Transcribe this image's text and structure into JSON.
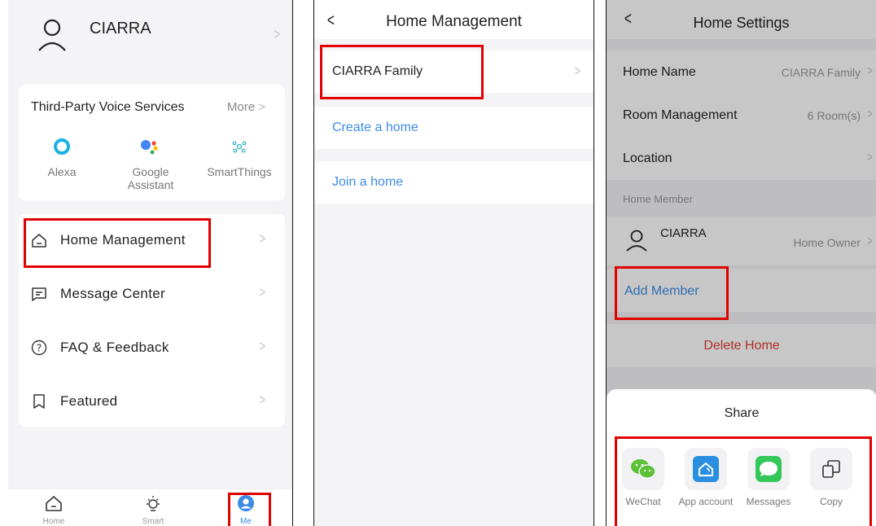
{
  "panel1": {
    "user_name": "CIARRA",
    "voice": {
      "title": "Third-Party Voice Services",
      "more": "More",
      "items": [
        {
          "label": "Alexa",
          "icon": "alexa-icon"
        },
        {
          "label": "Google Assistant",
          "icon": "google-assistant-icon"
        },
        {
          "label": "SmartThings",
          "icon": "smartthings-icon"
        }
      ]
    },
    "menu": [
      {
        "label": "Home Management",
        "icon": "home-icon"
      },
      {
        "label": "Message Center",
        "icon": "message-icon"
      },
      {
        "label": "FAQ & Feedback",
        "icon": "help-icon"
      },
      {
        "label": "Featured",
        "icon": "bookmark-icon"
      }
    ],
    "tabs": [
      {
        "label": "Home",
        "icon": "home-tab-icon"
      },
      {
        "label": "Smart",
        "icon": "sun-icon"
      },
      {
        "label": "Me",
        "icon": "user-tab-icon",
        "active": true
      }
    ]
  },
  "panel2": {
    "title": "Home Management",
    "family": "CIARRA Family",
    "create": "Create a home",
    "join": "Join a home"
  },
  "panel3": {
    "title": "Home Settings",
    "rows": [
      {
        "label": "Home Name",
        "value": "CIARRA Family"
      },
      {
        "label": "Room Management",
        "value": "6 Room(s)"
      },
      {
        "label": "Location",
        "value": ""
      }
    ],
    "member_section": "Home Member",
    "member_name": "CIARRA",
    "member_role": "Home Owner",
    "add_member": "Add Member",
    "delete_home": "Delete Home",
    "share": {
      "title": "Share",
      "items": [
        {
          "label": "WeChat",
          "icon": "wechat-icon"
        },
        {
          "label": "App account",
          "icon": "app-account-icon"
        },
        {
          "label": "Messages",
          "icon": "messages-icon"
        },
        {
          "label": "Copy",
          "icon": "copy-icon"
        }
      ]
    }
  },
  "colors": {
    "accent_blue": "#3d8be4",
    "highlight_red": "#e00000",
    "delete_red": "#e23b3b",
    "wechat_green": "#5bc236"
  }
}
